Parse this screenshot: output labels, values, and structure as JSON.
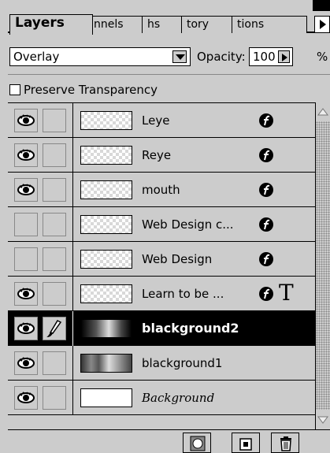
{
  "tabs": [
    {
      "label": "Layers",
      "active": true
    },
    {
      "label": "nnels",
      "active": false
    },
    {
      "label": "hs",
      "active": false
    },
    {
      "label": "tory",
      "active": false
    },
    {
      "label": "tions",
      "active": false
    }
  ],
  "options": {
    "blend_mode": "Overlay",
    "opacity_label": "Opacity:",
    "opacity_value": "100",
    "percent": "%"
  },
  "preserve_label": "Preserve Transparency",
  "layers": [
    {
      "name": "Leye",
      "visible": true,
      "effects": true,
      "selected": false
    },
    {
      "name": "Reye",
      "visible": true,
      "effects": true,
      "selected": false
    },
    {
      "name": "mouth",
      "visible": true,
      "effects": true,
      "selected": false
    },
    {
      "name": "Web Design c...",
      "visible": false,
      "effects": true,
      "selected": false
    },
    {
      "name": "Web Design",
      "visible": false,
      "effects": true,
      "selected": false
    },
    {
      "name": "Learn to be ...",
      "visible": true,
      "effects": true,
      "text_layer": true,
      "selected": false
    },
    {
      "name": "blackground2",
      "visible": true,
      "effects": false,
      "brush": true,
      "selected": true
    },
    {
      "name": "blackground1",
      "visible": true,
      "effects": false,
      "selected": false
    },
    {
      "name": "Background",
      "visible": true,
      "effects": false,
      "selected": false
    }
  ],
  "text_layer_glyph": "T",
  "icons": {
    "eye": "eye-icon",
    "brush": "paintbrush-icon",
    "effects": "layer-effects-icon",
    "mask": "add-mask-icon",
    "new_layer": "new-layer-icon",
    "trash": "trash-icon"
  }
}
